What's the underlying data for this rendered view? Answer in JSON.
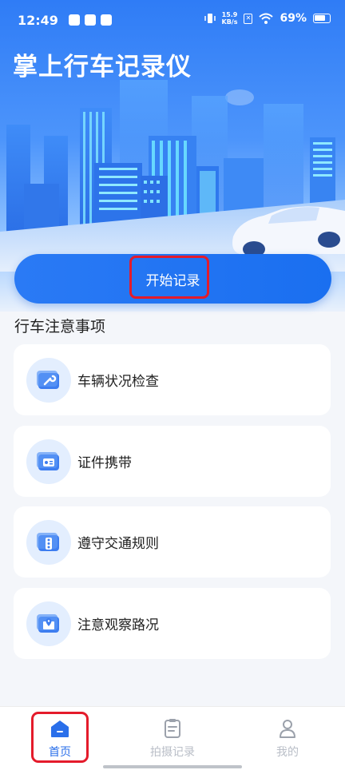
{
  "status_bar": {
    "time": "12:49",
    "net_speed_value": "15.9",
    "net_speed_unit": "KB/s",
    "battery": "69%"
  },
  "header": {
    "title": "掌上行车记录仪"
  },
  "start_button": {
    "label": "开始记录"
  },
  "section": {
    "title": "行车注意事项",
    "items": [
      {
        "label": "车辆状况检查",
        "icon": "wrench-icon"
      },
      {
        "label": "证件携带",
        "icon": "id-card-icon"
      },
      {
        "label": "遵守交通规则",
        "icon": "traffic-light-icon"
      },
      {
        "label": "注意观察路况",
        "icon": "map-pin-icon"
      }
    ]
  },
  "bottom_nav": {
    "items": [
      {
        "label": "首页",
        "icon": "home-icon",
        "active": true
      },
      {
        "label": "拍摄记录",
        "icon": "clipboard-icon",
        "active": false
      },
      {
        "label": "我的",
        "icon": "user-icon",
        "active": false
      }
    ]
  },
  "colors": {
    "primary": "#2a7af5",
    "highlight": "#e41b2b",
    "nav_active": "#2a6fea",
    "nav_inactive": "#b9bec7"
  }
}
